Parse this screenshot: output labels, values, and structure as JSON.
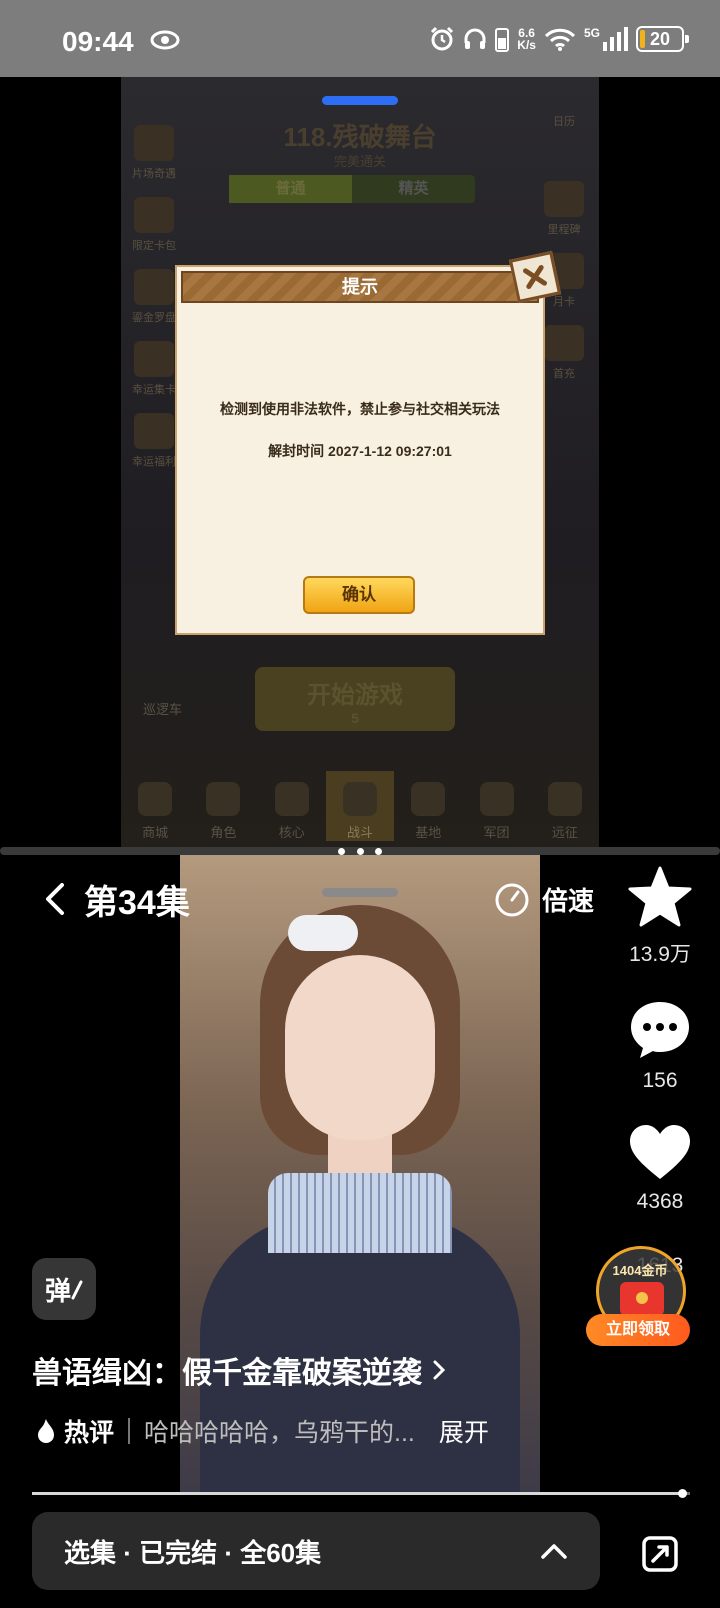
{
  "status_bar": {
    "time": "09:44",
    "net_speed_top": "6.6",
    "net_speed_bottom": "K/s",
    "network": "5G",
    "battery": "20",
    "icons": [
      "eye-icon",
      "alarm-icon",
      "headphones-icon",
      "phone-battery-icon",
      "wifi-icon",
      "signal-icon",
      "battery-icon"
    ]
  },
  "game": {
    "stage_title": "118.残破舞台",
    "stage_subtitle": "完美通关",
    "tabs": [
      {
        "label": "普通"
      },
      {
        "label": "精英"
      }
    ],
    "left_side": [
      {
        "label": "片场奇遇"
      },
      {
        "label": "限定卡包"
      },
      {
        "label": "鎏金罗盘"
      },
      {
        "label": "幸运集卡"
      },
      {
        "label": "幸运福利"
      }
    ],
    "right_side": [
      {
        "label": "日历"
      },
      {
        "label": "里程碑"
      },
      {
        "label": "月卡"
      },
      {
        "label": "首充"
      }
    ],
    "start_button": "开始游戏",
    "start_cost": "5",
    "patrol_label": "巡逻车",
    "nav": [
      {
        "label": "商城"
      },
      {
        "label": "角色"
      },
      {
        "label": "核心"
      },
      {
        "label": "战斗"
      },
      {
        "label": "基地"
      },
      {
        "label": "军团"
      },
      {
        "label": "远征"
      }
    ],
    "dialog": {
      "title": "提示",
      "message": "检测到使用非法软件，禁止参与社交相关玩法",
      "unban_time": "解封时间 2027-1-12 09:27:01",
      "confirm": "确认"
    }
  },
  "video": {
    "episode_title": "第34集",
    "speed_label": "倍速",
    "rail": {
      "favorites": "13.9万",
      "comments": "156",
      "likes": "4368",
      "shares": "1613"
    },
    "reward": {
      "coins": "1404金币",
      "claim": "立即领取"
    },
    "danmu_label": "弹",
    "drama_title": "兽语缉凶：假千金靠破案逆袭",
    "hot_label": "热评",
    "hot_comment": "哈哈哈哈哈，乌鸦干的...",
    "expand": "展开",
    "progress": 0.99,
    "episodes_bar": "选集 · 已完结 · 全60集"
  }
}
